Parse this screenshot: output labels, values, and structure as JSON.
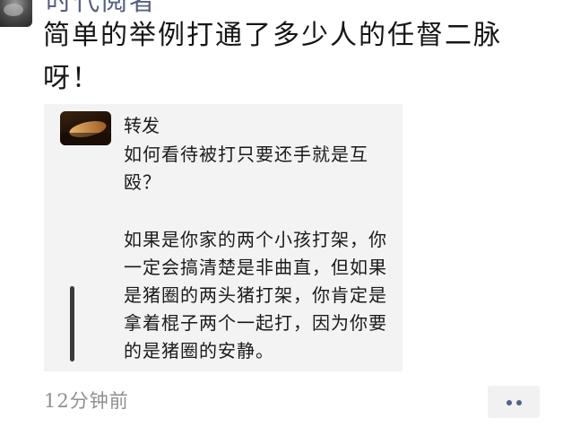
{
  "post": {
    "author_name": "时代阅者",
    "text": "简单的举例打通了多少人的任督二脉呀！",
    "timestamp": "12分钟前"
  },
  "shared_card": {
    "tag": "转发",
    "question": "如何看待被打只要还手就是互殴？",
    "body": "如果是你家的两个小孩打架，你一定会搞清楚是非曲直，但如果是猪圈的两头猪打架，你肯定是拿着棍子两个一起打，因为你要的是猪圈的安静。"
  },
  "icons": {
    "more": "more-options-icon",
    "avatar": "user-avatar",
    "thumbnail": "shared-thumbnail"
  },
  "colors": {
    "author_name": "#56617e",
    "card_background": "#f3f3f3",
    "timestamp": "#8f8f8f",
    "more_dots": "#566187"
  }
}
